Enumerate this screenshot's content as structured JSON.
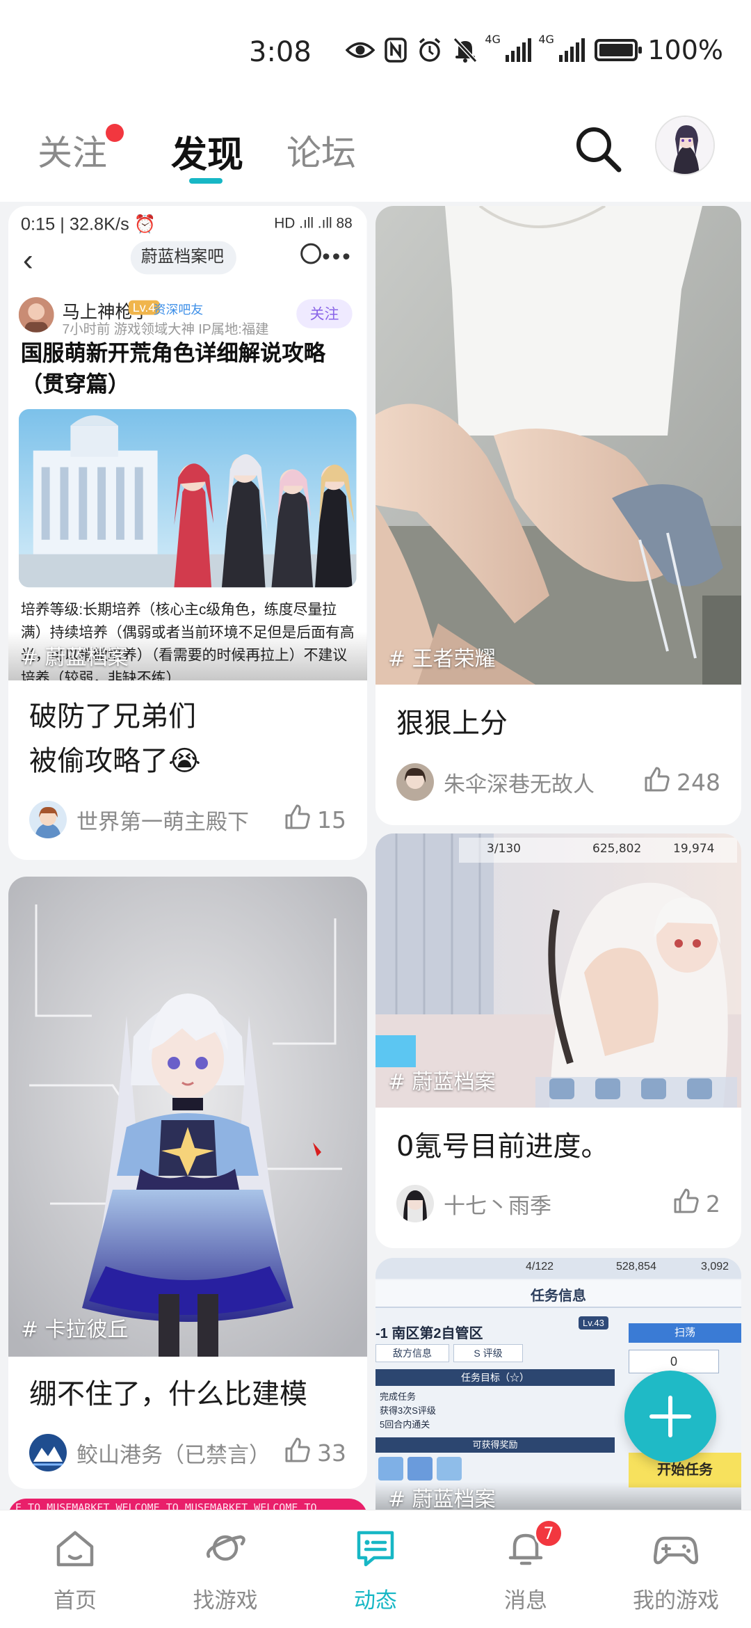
{
  "status_bar": {
    "time": "3:08",
    "network_1": "4G",
    "network_2": "4G",
    "battery": "100%",
    "battery_level": 1.0
  },
  "top_tabs": [
    {
      "label": "关注",
      "has_dot": true
    },
    {
      "label": "发现",
      "active": true
    },
    {
      "label": "论坛"
    }
  ],
  "posts": [
    {
      "topic": "# 蔚蓝档案",
      "title_line1": "破防了兄弟们",
      "title_line2": "被偷攻略了😭",
      "author": "世界第一萌主殿下",
      "likes": "15",
      "embedded": {
        "status_left": "0:15 | 32.8K/s ⏰",
        "status_right": "HD .ıll .ıll 88",
        "forum": "蔚蓝档案吧",
        "author": "马上神枪手",
        "level": "Lv.4",
        "badge": "资深吧友",
        "sub": "7小时前   游戏领域大神   IP属地:福建",
        "follow": "关注",
        "headline": "国服萌新开荒角色详细解说攻略（贯穿篇）",
        "body": "培养等级:长期培养（核心主c级角色，练度尽量拉满）持续培养（偶弱或者当前环境不足但是后面有高光，可以稍微培养）（看需要的时候再拉上）不建议培养（较弱，非缺不练）"
      }
    },
    {
      "topic": "# 王者荣耀",
      "title": "狠狠上分",
      "author": "朱伞深巷无故人",
      "likes": "248"
    },
    {
      "topic": "# 卡拉彼丘",
      "title": "绷不住了，什么比建模",
      "author": "鲛山港务（已禁言）",
      "likes": "33"
    },
    {
      "topic": "# 蔚蓝档案",
      "title": "0氪号目前进度。",
      "author": "十七丶雨季",
      "likes": "2",
      "game_hud": {
        "stamina": "3/130",
        "credits": "625,802",
        "gems": "19,974"
      }
    },
    {
      "topic": "# 蔚蓝档案",
      "game_panel": {
        "stamina": "4/122",
        "credits": "528,854",
        "gems": "3,092",
        "header": "任务信息",
        "stage": "-1  南区第2自管区",
        "level": "Lv.43",
        "enemy_info": "敌方信息",
        "rank": "S 评级",
        "goal_title": "任务目标（☆）",
        "goals": [
          "完成任务",
          "获得3次S评级",
          "5回合内通关"
        ],
        "reward": "可获得奖励",
        "sweep": "扫荡",
        "count": "0",
        "start": "开始任务"
      }
    }
  ],
  "banner_text": "E TO MUSEMARKET   WELCOME TO MUSEMARKET   WELCOME TO",
  "bottom_nav": [
    {
      "label": "首页",
      "icon": "home-icon"
    },
    {
      "label": "找游戏",
      "icon": "planet-icon"
    },
    {
      "label": "动态",
      "icon": "chat-icon",
      "active": true
    },
    {
      "label": "消息",
      "icon": "bell-icon",
      "badge": "7"
    },
    {
      "label": "我的游戏",
      "icon": "gamepad-icon"
    }
  ],
  "colors": {
    "accent": "#17b7c5",
    "badge_red": "#f2373f"
  }
}
